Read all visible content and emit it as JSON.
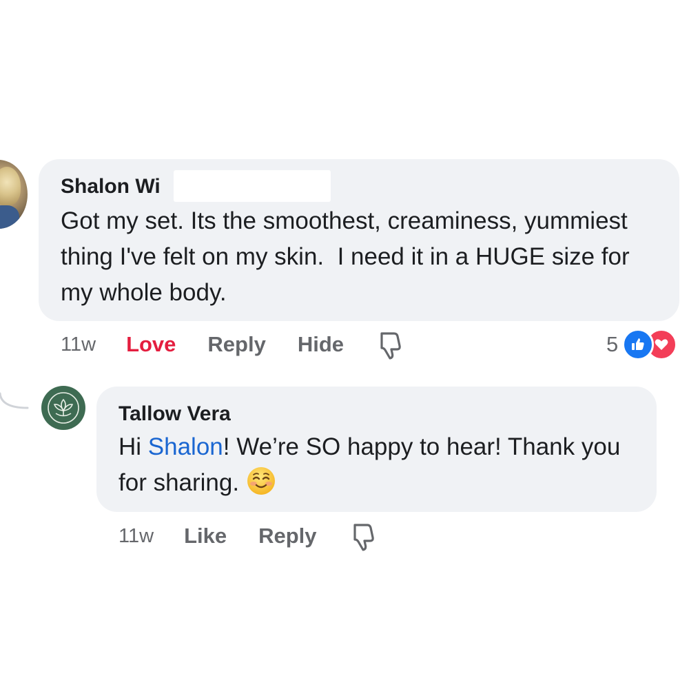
{
  "comment": {
    "author": "Shalon Wi",
    "text": "Got my set. Its the smoothest, creaminess, yummiest thing I've felt on my skin.  I need it in a HUGE size for my whole body.",
    "time": "11w",
    "actions": {
      "love_label": "Love",
      "reply_label": "Reply",
      "hide_label": "Hide"
    },
    "reactions": {
      "count": "5",
      "types": [
        "like",
        "love"
      ],
      "like_color": "#1877f2",
      "love_color": "#f33e58"
    },
    "love_color": "#e41e3f"
  },
  "reply": {
    "author": "Tallow Vera",
    "greeting": "Hi ",
    "mention": "Shalon",
    "text": "! We’re SO happy to hear! Thank you for sharing.",
    "emoji": "smiling-face-with-smiling-eyes",
    "time": "11w",
    "actions": {
      "like_label": "Like",
      "reply_label": "Reply"
    },
    "avatar_color": "#3e6b52",
    "mention_color": "#1a66d1"
  },
  "icons": {
    "thumbs_down": "thumbs-down-icon",
    "like_reaction": "like-reaction-icon",
    "love_reaction": "love-reaction-icon"
  },
  "theme": {
    "bubble_bg": "#f0f2f5",
    "secondary_text": "#65676b",
    "primary_text": "#1c1e21"
  }
}
